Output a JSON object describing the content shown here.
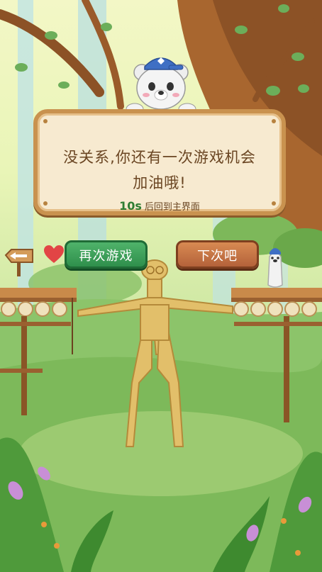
{
  "dialog": {
    "line1": "没关系,你还有一次游戏机会",
    "line2": "加油哦!",
    "countdown_number": "10s",
    "countdown_text": "后回到主界面"
  },
  "buttons": {
    "retry_label": "再次游戏",
    "later_label": "下次吧"
  },
  "icons": {
    "back": "back-arrow-sign-icon",
    "heart": "heart-icon",
    "bear": "bear-mascot-icon",
    "seal": "seal-mascot-icon"
  },
  "colors": {
    "retry_button": "#3aa457",
    "later_button": "#c47447",
    "dialog_bg": "#f7ead0",
    "dialog_border": "#c9924f",
    "text": "#6a4522"
  }
}
